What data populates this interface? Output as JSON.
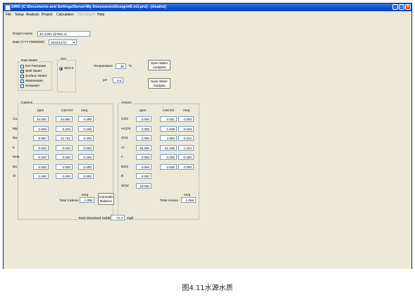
{
  "window": {
    "title": "SIRO [C:\\Documents and Settings\\Server\\My Documents\\Design\\45 m3.pro] - [Analist]"
  },
  "menu": [
    "File",
    "Setup",
    "Analysis",
    "Project",
    "Calculation",
    "Hint Report",
    "Help"
  ],
  "menu_disabled": [
    false,
    false,
    false,
    false,
    false,
    true,
    false
  ],
  "project": {
    "name_label": "Project name",
    "name_value": "40 m3/hr @75% re",
    "date_label": "Date (YYYY/MM/DD)",
    "date_value": "2010/12/17"
  },
  "raw_water": {
    "caption": "Raw Water",
    "options": [
      "RO Permeate",
      "Well Water",
      "Surface Water",
      "Wastewater",
      "Seawater"
    ],
    "checked": [
      false,
      true,
      false,
      false,
      false
    ]
  },
  "sdi": {
    "caption": "SDI",
    "option": "SDI<3",
    "selected": true
  },
  "temperature": {
    "label": "Temperature",
    "value": "25",
    "unit": "°C"
  },
  "ph": {
    "label": "pH",
    "value": "6.5"
  },
  "buttons": {
    "open": "Open Water Analyses",
    "save": "Save Water Analysis",
    "balance": "Automatic Balance"
  },
  "cations": {
    "caption": "Cations",
    "headers": [
      "ppm",
      "CaCO3",
      "meq"
    ],
    "rows": [
      {
        "ion": "Ca",
        "ppm": "10.000",
        "caco3": "24.950",
        "meq": "0.499"
      },
      {
        "ion": "Mg",
        "ppm": "2.000",
        "caco3": "8.226",
        "meq": "0.165"
      },
      {
        "ion": "Na",
        "ppm": "9.997",
        "caco3": "21.741",
        "meq": "0.435"
      },
      {
        "ion": "K",
        "ppm": "0.000",
        "caco3": "0.000",
        "meq": "0.000"
      },
      {
        "ion": "NH4",
        "ppm": "0.000",
        "caco3": "0.000",
        "meq": "0.000"
      },
      {
        "ion": "Ba",
        "ppm": "0.000",
        "caco3": "0.000",
        "meq": "0.000"
      },
      {
        "ion": "Sr",
        "ppm": "0.000",
        "caco3": "0.000",
        "meq": "0.000"
      }
    ],
    "total_label": "Total Cations",
    "total_unit": "meq",
    "total_value": "1.098"
  },
  "anions": {
    "caption": "Anions",
    "headers": [
      "ppm",
      "CaCO3",
      "meq"
    ],
    "rows": [
      {
        "ion": "CO3",
        "ppm": "0.000",
        "caco3": "0.001",
        "meq": "0.000"
      },
      {
        "ion": "HCO3",
        "ppm": "2.000",
        "caco3": "1.639",
        "meq": "0.033"
      },
      {
        "ion": "SO4",
        "ppm": "2.000",
        "caco3": "2.083",
        "meq": "0.042"
      },
      {
        "ion": "Cl",
        "ppm": "36.300",
        "caco3": "51.195",
        "meq": "1.024"
      },
      {
        "ion": "F",
        "ppm": "0.000",
        "caco3": "0.000",
        "meq": "0.000"
      },
      {
        "ion": "NO3",
        "ppm": "0.000",
        "caco3": "0.000",
        "meq": "0.000"
      },
      {
        "ion": "B",
        "ppm": "0.000",
        "caco3": "",
        "meq": ""
      },
      {
        "ion": "SiO2",
        "ppm": "10.000",
        "caco3": "",
        "meq": ""
      }
    ],
    "total_label": "Total Anions",
    "total_unit": "meq",
    "total_value": "1.098"
  },
  "tds": {
    "label": "Total Dissolved Solids",
    "value": "72.3",
    "unit": "mg/l"
  },
  "caption": "图4.11水源水质"
}
